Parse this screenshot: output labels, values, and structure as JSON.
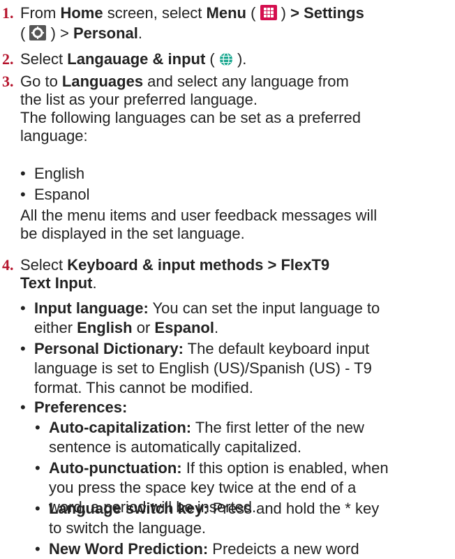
{
  "steps": [
    {
      "number": "1.",
      "parts": [
        "From ",
        "Home",
        " screen, select ",
        "Menu",
        " ( ",
        " ) ",
        "> Settings",
        "( ",
        " ) > ",
        "Personal",
        "."
      ]
    },
    {
      "number": "2.",
      "parts": [
        "Select ",
        "Langauage & input",
        " ( ",
        " )."
      ]
    },
    {
      "number": "3.",
      "parts": [
        "Go to ",
        "Languages",
        " and select any language from",
        "the list as your preferred language.",
        "The following languages can be set as a preferred",
        "language:"
      ]
    },
    {
      "number": "4.",
      "parts": [
        "Select ",
        "Keyboard & input methods > FlexT9",
        "Text Input",
        "."
      ]
    }
  ],
  "languages": [
    "English",
    "Espanol"
  ],
  "language_note": [
    "All the menu items and user feedback messages will",
    "be displayed in the set language."
  ],
  "options": [
    {
      "term": "Input language:",
      "lines": [
        " You can set the input language to",
        "either ",
        "English",
        " or ",
        "Espanol",
        "."
      ]
    },
    {
      "term": "Personal Dictionary:",
      "lines": [
        " The default keyboard input",
        "language is set to English (US)/Spanish (US) - T9",
        "format. This cannot be modified."
      ]
    },
    {
      "term": "Preferences:",
      "lines": []
    }
  ],
  "preferences": [
    {
      "term": "Auto-capitalization:",
      "lines": [
        " The first letter of the new",
        "sentence is automatically capitalized."
      ]
    },
    {
      "term": "Auto-punctuation:",
      "lines": [
        " If this option is enabled, when",
        "you press the space key twice at the end of a",
        "word, a period will be inserted."
      ]
    },
    {
      "term": "Language switch key:",
      "lines": [
        " Press and hold the * key",
        "to switch the language."
      ]
    },
    {
      "term": "New Word Prediction:",
      "lines": [
        " Predeicts a new word"
      ]
    }
  ],
  "bullet_char": "•",
  "colors": {
    "step_number": "#b5122b",
    "text": "#222222",
    "globe_icon": "#12a58c",
    "menu_icon_bg": "#d40f4f",
    "settings_icon_bg": "#555555"
  },
  "icons": [
    "menu-grid-icon",
    "settings-gear-icon",
    "globe-icon"
  ]
}
